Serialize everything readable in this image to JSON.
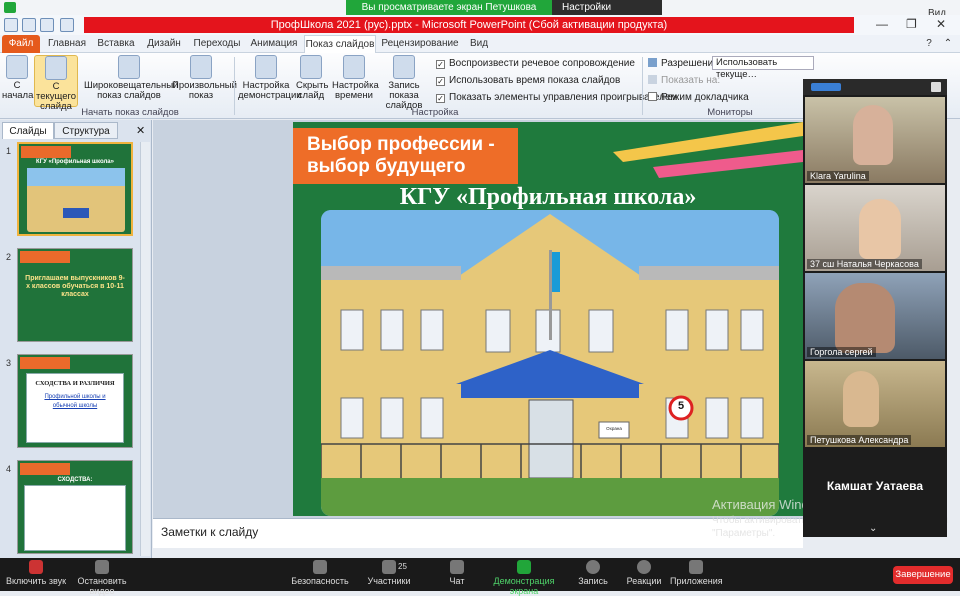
{
  "zoom_banner": {
    "viewing_text": "Вы просматриваете экран Петушкова Александра",
    "view_settings": "Настройки просмотра ▾",
    "view_label": "Вид"
  },
  "window": {
    "title": "ПрофШкола 2021 (рус).pptx  -  Microsoft PowerPoint (Сбой активации продукта)"
  },
  "tabs": [
    "Файл",
    "Главная",
    "Вставка",
    "Дизайн",
    "Переходы",
    "Анимация",
    "Показ слайдов",
    "Рецензирование",
    "Вид"
  ],
  "ribbon": {
    "buttons": {
      "from_start": "С начала",
      "from_current": "С текущего слайда",
      "broadcast": "Широковещательный показ слайдов",
      "custom": "Произвольный показ",
      "setup": "Настройка демонстрации",
      "hide": "Скрыть слайд",
      "rehearse": "Настройка времени",
      "record": "Запись показа слайдов"
    },
    "checks": {
      "narration": "Воспроизвести речевое сопровождение",
      "timings": "Использовать время показа слайдов",
      "media_controls": "Показать элементы управления проигрывателем"
    },
    "monitors": {
      "resolution_label": "Разрешение:",
      "resolution_value": "Использовать текуще…",
      "show_on": "Показать на:",
      "presenter_view": "Режим докладчика"
    },
    "groups": {
      "start": "Начать показ слайдов",
      "setup": "Настройка",
      "monitors": "Мониторы"
    }
  },
  "left_pane": {
    "tabs": [
      "Слайды",
      "Структура"
    ],
    "close": "✕",
    "thumbs": [
      {
        "num": "1",
        "title": "КГУ «Профильная школа»"
      },
      {
        "num": "2",
        "title": "Приглашаем выпускников 9-х классов обучаться в 10-11 классах"
      },
      {
        "num": "3",
        "title": "СХОДСТВА И РАЗЛИЧИЯ",
        "sub": "Профильной школы и обычной школы"
      },
      {
        "num": "4",
        "title": "СХОДСТВА:"
      }
    ]
  },
  "slide": {
    "banner": "Выбор профессии - выбор будущего",
    "title": "КГУ «Профильная школа»",
    "photo": {
      "sign_number": "5",
      "gate_sign": "Охрана"
    }
  },
  "notes_placeholder": "Заметки к слайду",
  "watermark": {
    "line1": "Активация Windows",
    "line2": "Чтобы активировать Windows, перейдите в раздел \"Параметры\"."
  },
  "gallery": {
    "participants": [
      {
        "name": "Klara Yarulina"
      },
      {
        "name": "37 сш  Наталья Черкасова"
      },
      {
        "name": "Горгола сергей"
      },
      {
        "name": "Петушкова Александра"
      }
    ],
    "active_speaker": "Камшат Уатаева"
  },
  "zoom_bar": {
    "mute": "Включить звук",
    "video": "Остановить видео",
    "security": "Безопасность",
    "participants": "Участники",
    "participants_count": "25",
    "chat": "Чат",
    "share": "Демонстрация экрана",
    "record": "Запись",
    "reactions": "Реакции",
    "apps": "Приложения",
    "end": "Завершение"
  },
  "colors": {
    "ppt_title_red": "#e4141c",
    "zoom_green": "#21a63a",
    "slide_green": "#1f7a3d",
    "banner_orange": "#ee6d28",
    "end_red": "#e22c2c"
  }
}
